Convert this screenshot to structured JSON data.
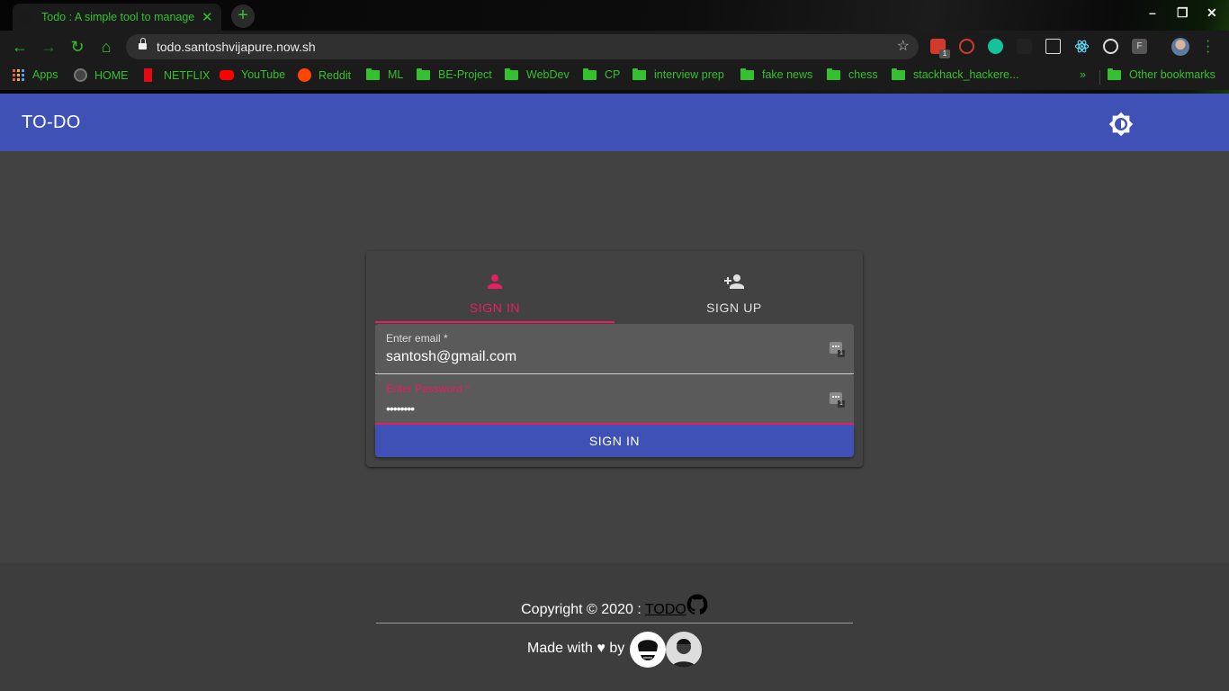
{
  "browser": {
    "tab_title": "Todo : A simple tool to manage",
    "tab_close": "✕",
    "new_tab": "+",
    "url": "todo.santoshvijapure.now.sh",
    "ext_badge": "1",
    "ext_f_label": "F",
    "window_controls": {
      "minimize": "–",
      "maximize": "❐",
      "close": "✕"
    },
    "bookmarks": [
      {
        "label": "Apps",
        "icon": "apps-grid-icon"
      },
      {
        "label": "HOME",
        "icon": "github-icon"
      },
      {
        "label": "NETFLIX",
        "icon": "netflix-icon"
      },
      {
        "label": "YouTube",
        "icon": "youtube-icon"
      },
      {
        "label": "Reddit",
        "icon": "reddit-icon"
      },
      {
        "label": "ML",
        "icon": "folder-icon"
      },
      {
        "label": "BE-Project",
        "icon": "folder-icon"
      },
      {
        "label": "WebDev",
        "icon": "folder-icon"
      },
      {
        "label": "CP",
        "icon": "folder-icon"
      },
      {
        "label": "interview prep",
        "icon": "folder-icon"
      },
      {
        "label": "fake news",
        "icon": "folder-icon"
      },
      {
        "label": "chess",
        "icon": "folder-icon"
      },
      {
        "label": "stackhack_hackere...",
        "icon": "folder-icon"
      }
    ],
    "overflow": "»",
    "other_bookmarks": "Other bookmarks",
    "accent": "#35c12d"
  },
  "app": {
    "title": "TO-DO",
    "theme_icon": "brightness-icon",
    "primary": "#3f51b5",
    "secondary": "#e91e63",
    "tabs": [
      {
        "label": "SIGN IN",
        "icon": "person-icon",
        "active": true
      },
      {
        "label": "SIGN UP",
        "icon": "person-add-icon",
        "active": false
      }
    ],
    "email": {
      "label": "Enter email *",
      "value": "santosh@gmail.com"
    },
    "password": {
      "label": "Enter Password *",
      "value": "••••••••"
    },
    "submit": "SIGN IN"
  },
  "footer": {
    "copyright_prefix": "Copyright © 2020 : ",
    "link": "TODO",
    "made_with": "Made with ♥ by"
  }
}
